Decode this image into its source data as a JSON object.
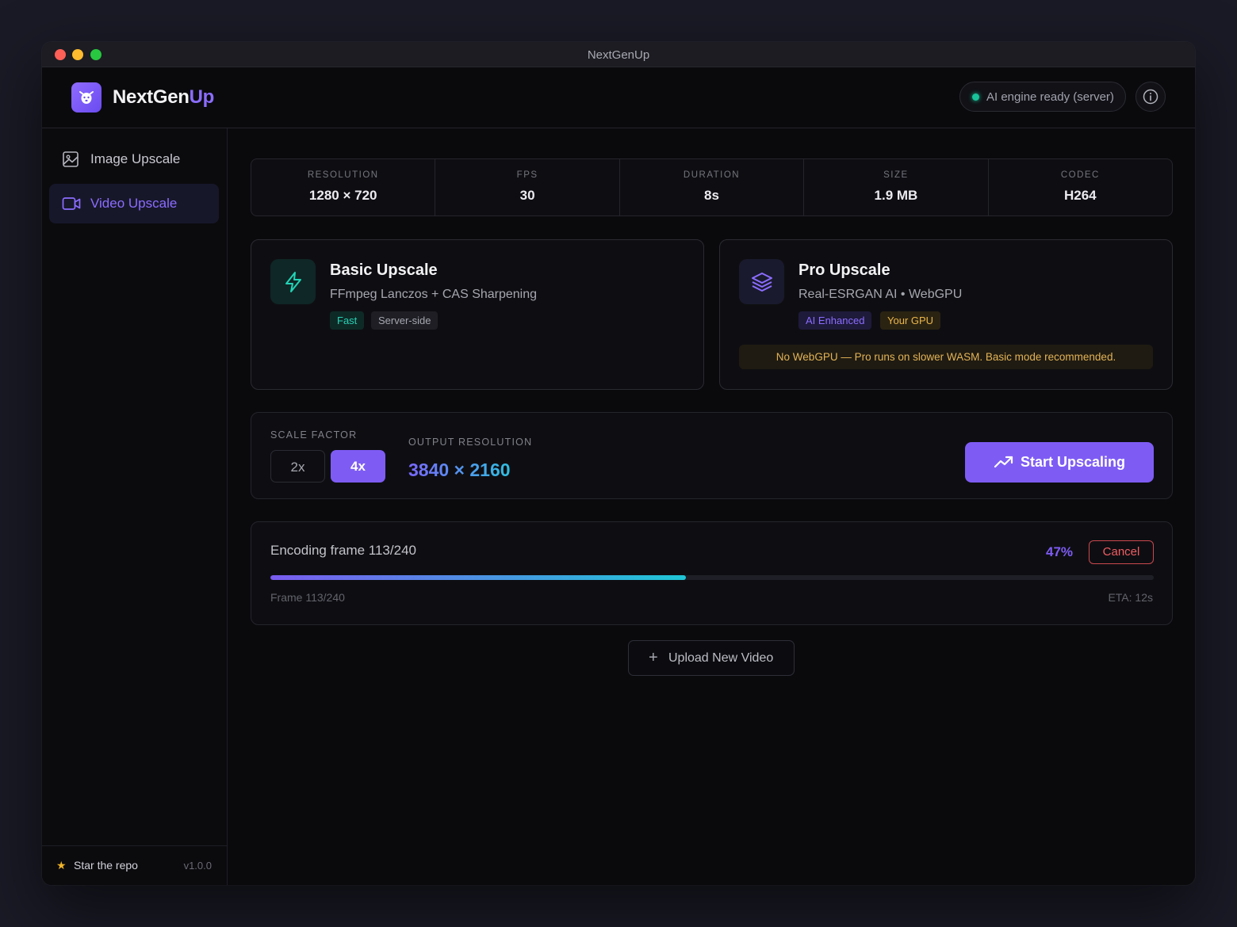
{
  "window": {
    "title": "NextGenUp"
  },
  "header": {
    "brand_part1": "NextGen",
    "brand_part2": "Up",
    "logo_icon": "dog-face-icon",
    "status_text": "AI engine ready (server)",
    "status_color": "#19c39a",
    "info_icon": "info-icon"
  },
  "sidebar": {
    "items": [
      {
        "label": "Image Upscale",
        "icon": "image-icon",
        "active": false
      },
      {
        "label": "Video Upscale",
        "icon": "video-camera-icon",
        "active": true
      }
    ],
    "footer": {
      "star_label": "Star the repo",
      "version": "v1.0.0"
    }
  },
  "stats": [
    {
      "key": "RESOLUTION",
      "value": "1280 × 720"
    },
    {
      "key": "FPS",
      "value": "30"
    },
    {
      "key": "DURATION",
      "value": "8s"
    },
    {
      "key": "SIZE",
      "value": "1.9 MB"
    },
    {
      "key": "CODEC",
      "value": "H264"
    }
  ],
  "modes": {
    "basic": {
      "title": "Basic Upscale",
      "subtitle": "FFmpeg Lanczos + CAS Sharpening",
      "icon": "lightning-icon",
      "tags": [
        "Fast",
        "Server-side"
      ]
    },
    "pro": {
      "title": "Pro Upscale",
      "subtitle": "Real-ESRGAN AI • WebGPU",
      "icon": "layers-icon",
      "tags": [
        "AI Enhanced",
        "Your GPU"
      ],
      "warning": "No WebGPU — Pro runs on slower WASM. Basic mode recommended."
    }
  },
  "scale": {
    "label": "SCALE FACTOR",
    "options": [
      "2x",
      "4x"
    ],
    "selected": "4x",
    "output_label": "OUTPUT RESOLUTION",
    "output_value": "3840 × 2160",
    "start_label": "Start Upscaling",
    "accent": "#7e5cf4"
  },
  "progress": {
    "status": "Encoding frame 113/240",
    "percent_label": "47%",
    "percent": 47,
    "cancel_label": "Cancel",
    "frame": "Frame 113/240",
    "eta": "ETA: 12s"
  },
  "upload": {
    "label": "Upload New Video"
  }
}
